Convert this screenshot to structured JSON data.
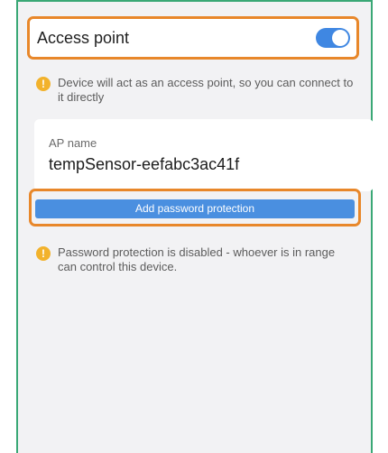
{
  "access_point": {
    "title": "Access point",
    "enabled": true
  },
  "info_notice": "Device will act as an access point, so you can connect to it directly",
  "ap_name": {
    "label": "AP name",
    "value": "tempSensor-eefabc3ac41f"
  },
  "password": {
    "button_label": "Add password protection",
    "warning": "Password protection is disabled - whoever is in range can control this device."
  },
  "colors": {
    "highlight": "#e8872a",
    "accent": "#4a8fe0",
    "frame_border": "#3aa876",
    "warning_icon": "#f2b22c"
  },
  "icons": {
    "info": "warning-info-icon",
    "toggle": "toggle-switch"
  }
}
